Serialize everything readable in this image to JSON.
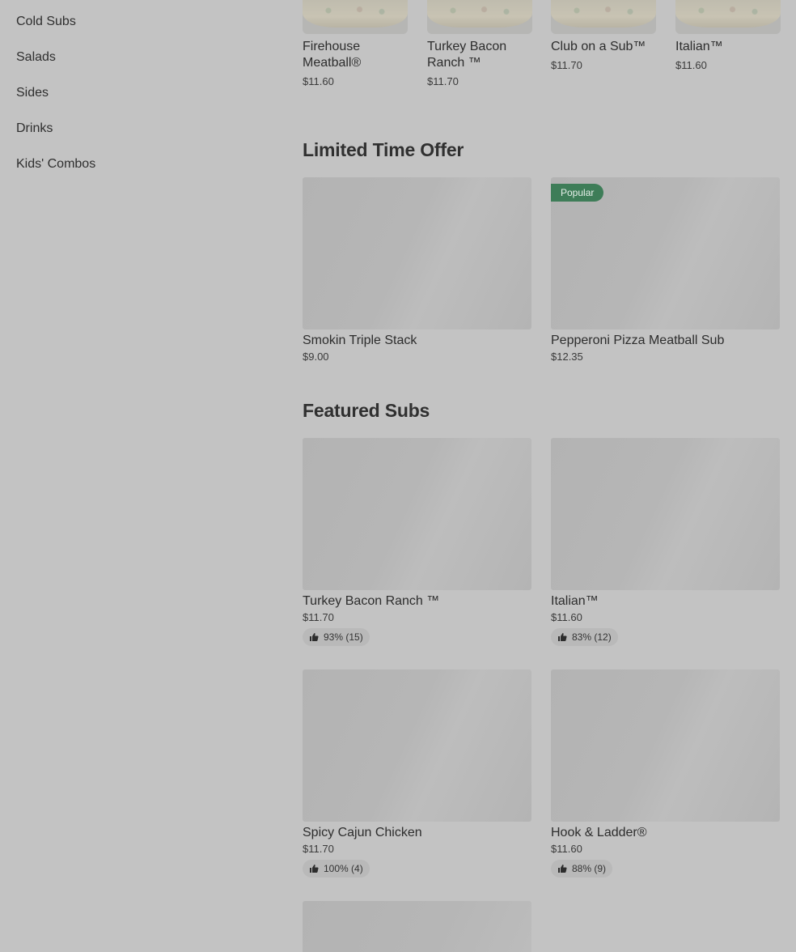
{
  "sidebar": {
    "items": [
      {
        "label": "Cold Subs"
      },
      {
        "label": "Salads"
      },
      {
        "label": "Sides"
      },
      {
        "label": "Drinks"
      },
      {
        "label": "Kids' Combos"
      }
    ]
  },
  "top_row": [
    {
      "name": "Firehouse Meatball®",
      "price": "$11.60"
    },
    {
      "name": "Turkey Bacon Ranch ™",
      "price": "$11.70"
    },
    {
      "name": "Club on a Sub™",
      "price": "$11.70"
    },
    {
      "name": "Italian™",
      "price": "$11.60"
    }
  ],
  "limited": {
    "title": "Limited Time Offer",
    "items": [
      {
        "name": "Smokin Triple Stack",
        "price": "$9.00",
        "badge": ""
      },
      {
        "name": "Pepperoni Pizza Meatball Sub",
        "price": "$12.35",
        "badge": "Popular"
      }
    ]
  },
  "featured": {
    "title": "Featured Subs",
    "items": [
      {
        "name": "Turkey Bacon Ranch ™",
        "price": "$11.70",
        "rating": "93% (15)"
      },
      {
        "name": "Italian™",
        "price": "$11.60",
        "rating": "83% (12)"
      },
      {
        "name": "Spicy Cajun Chicken",
        "price": "$11.70",
        "rating": "100% (4)"
      },
      {
        "name": "Hook & Ladder®",
        "price": "$11.60",
        "rating": "88% (9)"
      }
    ]
  },
  "colors": {
    "badge": "#3e7d58",
    "background": "#c3c3c3"
  }
}
